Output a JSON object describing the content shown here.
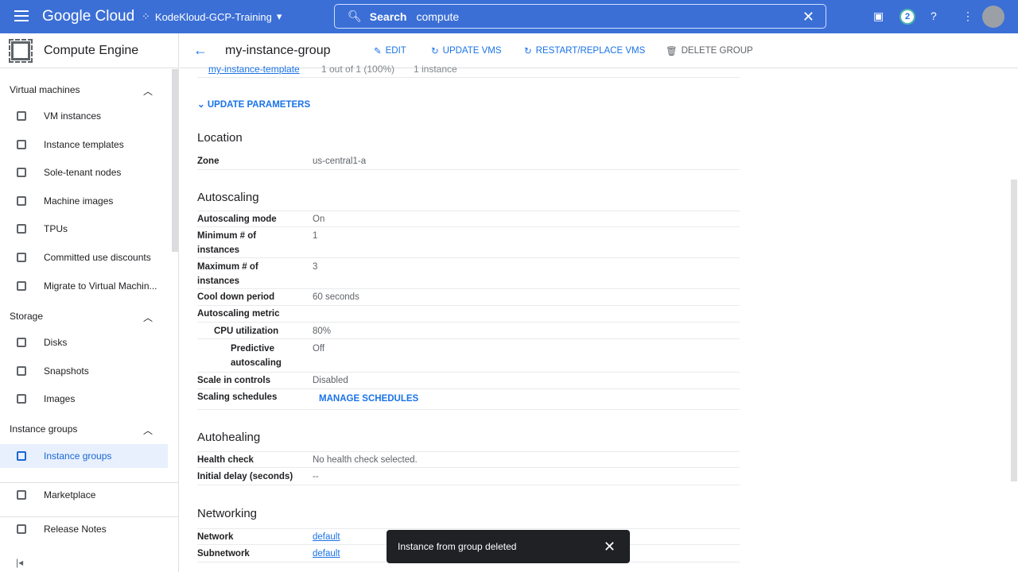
{
  "header": {
    "logo": "Google Cloud",
    "project": "KodeKloud-GCP-Training",
    "search_label": "Search",
    "search_value": "compute",
    "notifications": "2"
  },
  "sidebar": {
    "product": "Compute Engine",
    "sections": [
      {
        "label": "Virtual machines"
      },
      {
        "label": "Storage"
      },
      {
        "label": "Instance groups"
      }
    ],
    "items": [
      {
        "label": "VM instances"
      },
      {
        "label": "Instance templates"
      },
      {
        "label": "Sole-tenant nodes"
      },
      {
        "label": "Machine images"
      },
      {
        "label": "TPUs"
      },
      {
        "label": "Committed use discounts"
      },
      {
        "label": "Migrate to Virtual Machin..."
      },
      {
        "label": "Disks"
      },
      {
        "label": "Snapshots"
      },
      {
        "label": "Images"
      },
      {
        "label": "Instance groups"
      },
      {
        "label": "Marketplace"
      },
      {
        "label": "Release Notes"
      }
    ]
  },
  "toolbar": {
    "title": "my-instance-group",
    "edit": "EDIT",
    "update_vms": "UPDATE VMS",
    "restart": "RESTART/REPLACE VMS",
    "delete": "DELETE GROUP"
  },
  "content": {
    "partial_row": [
      "my-instance-template",
      "1 out of 1 (100%)",
      "1 instance"
    ],
    "update_parameters": "UPDATE PARAMETERS",
    "location": {
      "title": "Location",
      "rows": [
        {
          "k": "Zone",
          "v": "us-central1-a"
        }
      ]
    },
    "autoscaling": {
      "title": "Autoscaling",
      "rows": [
        {
          "k": "Autoscaling mode",
          "v": "On"
        },
        {
          "k": "Minimum # of instances",
          "v": "1"
        },
        {
          "k": "Maximum # of instances",
          "v": "3"
        },
        {
          "k": "Cool down period",
          "v": "60 seconds"
        },
        {
          "k": "Autoscaling metric",
          "v": ""
        },
        {
          "k": "CPU utilization",
          "v": "80%"
        },
        {
          "k": "Predictive autoscaling",
          "v": "Off"
        },
        {
          "k": "Scale in controls",
          "v": "Disabled"
        },
        {
          "k": "Scaling schedules",
          "v": "MANAGE SCHEDULES"
        }
      ]
    },
    "autohealing": {
      "title": "Autohealing",
      "rows": [
        {
          "k": "Health check",
          "v": "No health check selected."
        },
        {
          "k": "Initial delay (seconds)",
          "v": "--"
        }
      ]
    },
    "networking": {
      "title": "Networking",
      "rows": [
        {
          "k": "Network",
          "v": "default"
        },
        {
          "k": "Subnetwork",
          "v": "default"
        }
      ]
    }
  },
  "toast": {
    "message": "Instance from group deleted"
  }
}
